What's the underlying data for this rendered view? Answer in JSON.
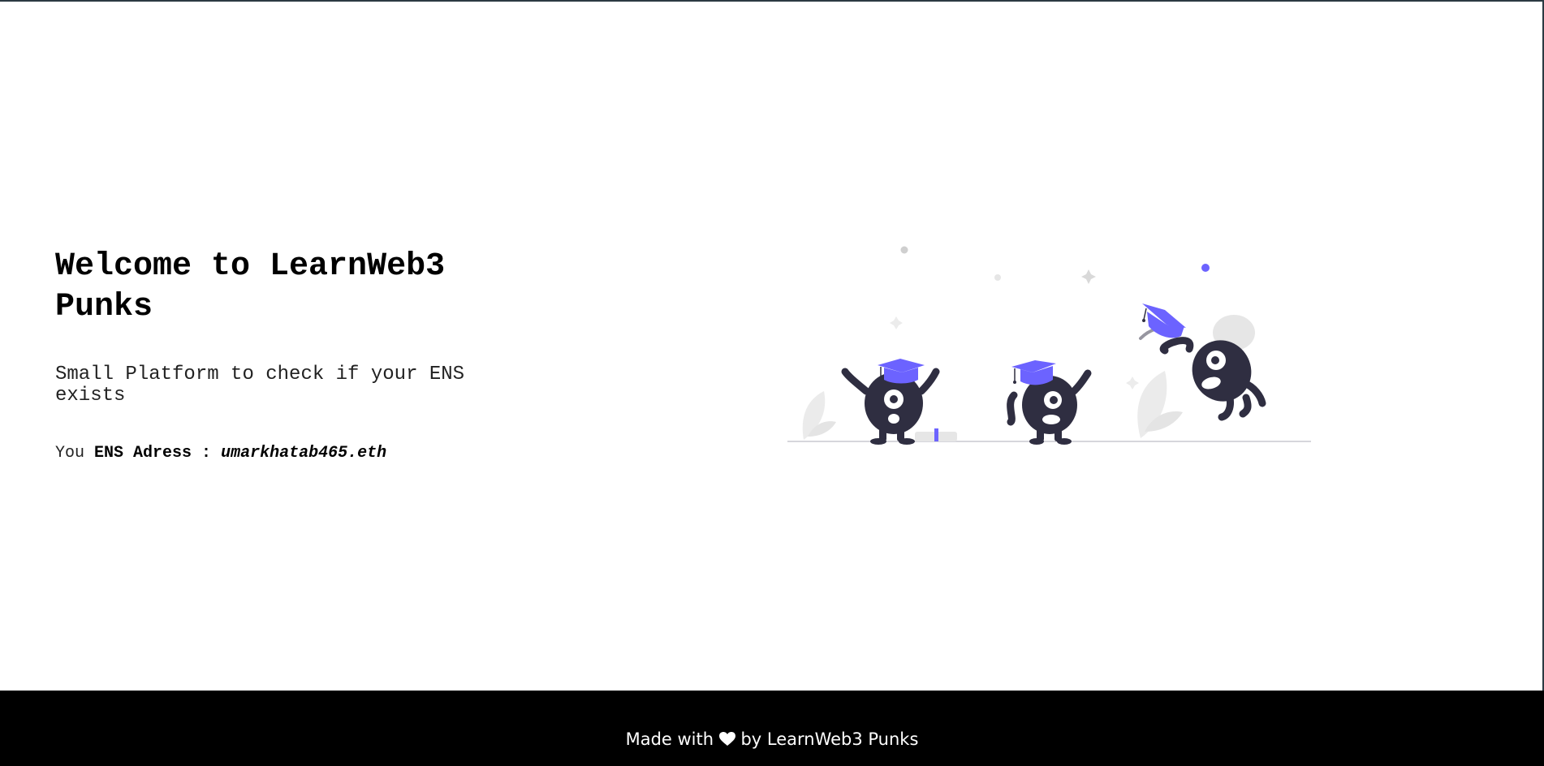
{
  "hero": {
    "title": "Welcome to LearnWeb3 Punks",
    "subtitle": "Small Platform to check if your ENS exists",
    "ens_prefix": "You",
    "ens_label": "ENS Adress :",
    "ens_value": "umarkhatab465.eth"
  },
  "illustration": {
    "icon": "graduation-celebration-illustration",
    "accent": "#6c63ff",
    "character_color": "#2f2e41"
  },
  "footer": {
    "text_before": "Made with",
    "heart_icon": "heart-icon",
    "text_after": "by LearnWeb3 Punks"
  }
}
